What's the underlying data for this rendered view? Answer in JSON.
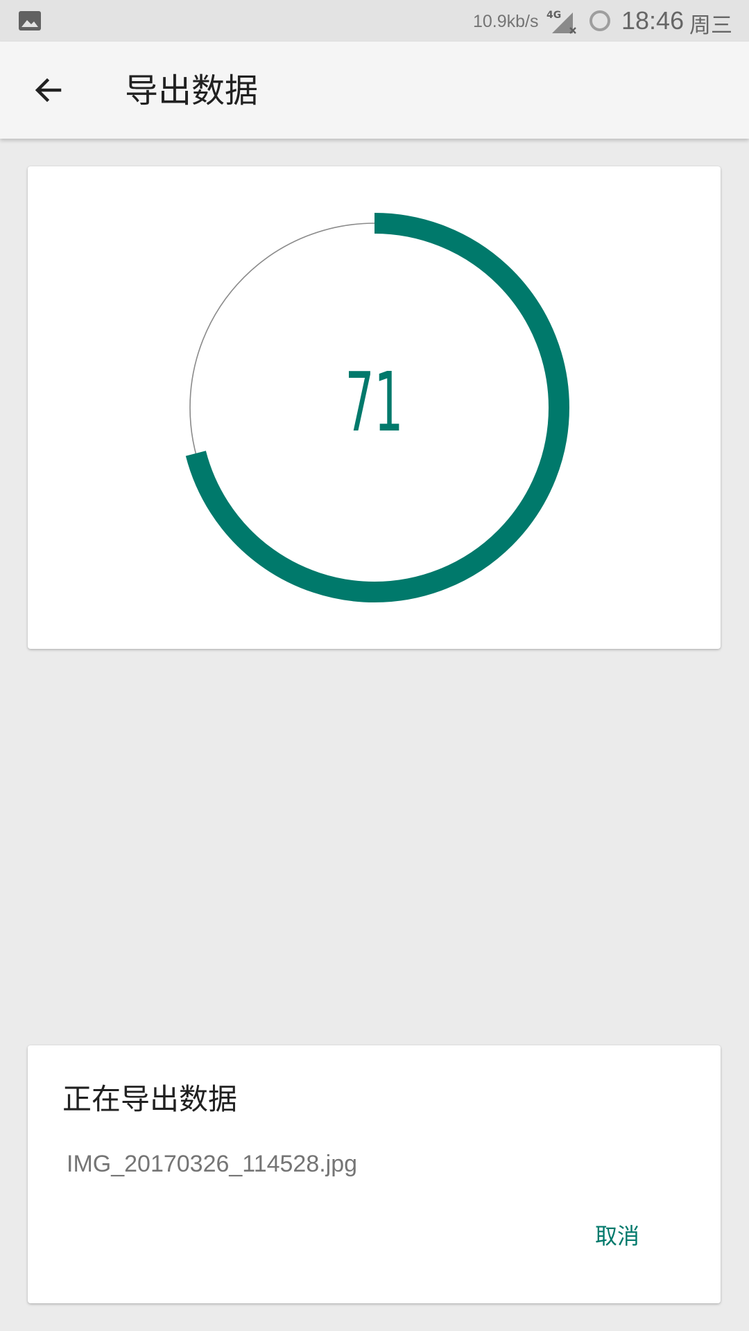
{
  "status_bar": {
    "network_speed": "10.9kb/s",
    "network_type": "4G",
    "time": "18:46",
    "day": "周三",
    "icons": [
      "gallery-icon",
      "signal-4g-icon",
      "loading-ring-icon"
    ]
  },
  "app_bar": {
    "title": "导出数据",
    "back_icon": "arrow-left-icon"
  },
  "progress": {
    "value": "71",
    "fraction": 0.71,
    "accent_color": "#00796b"
  },
  "dialog": {
    "title": "正在导出数据",
    "filename": "IMG_20170326_114528.jpg",
    "cancel_label": "取消"
  }
}
